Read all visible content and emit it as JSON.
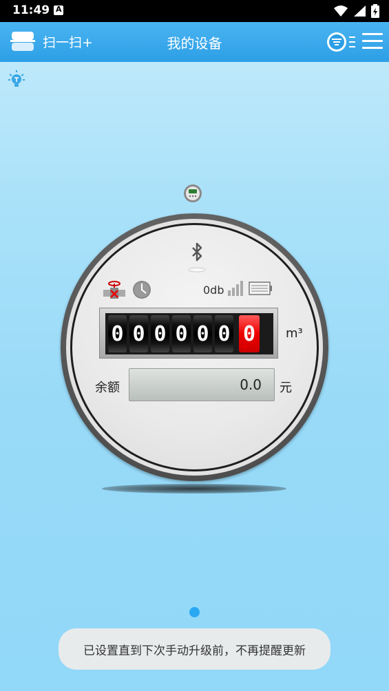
{
  "status_bar": {
    "time": "11:49",
    "notification_icon": "A"
  },
  "app_bar": {
    "scan_label": "扫一扫+",
    "title": "我的设备"
  },
  "meter": {
    "signal": "0db",
    "reading_digits": [
      "0",
      "0",
      "0",
      "0",
      "0",
      "0"
    ],
    "reading_decimal": "0",
    "unit": "m³",
    "balance_label": "余额",
    "balance_value": "0.0",
    "currency": "元"
  },
  "toast": {
    "message": "已设置直到下次手动升级前，不再提醒更新"
  },
  "colors": {
    "app_bar": "#2d9fe6",
    "accent_red": "#e00000",
    "page_dot": "#2aa8f2"
  }
}
